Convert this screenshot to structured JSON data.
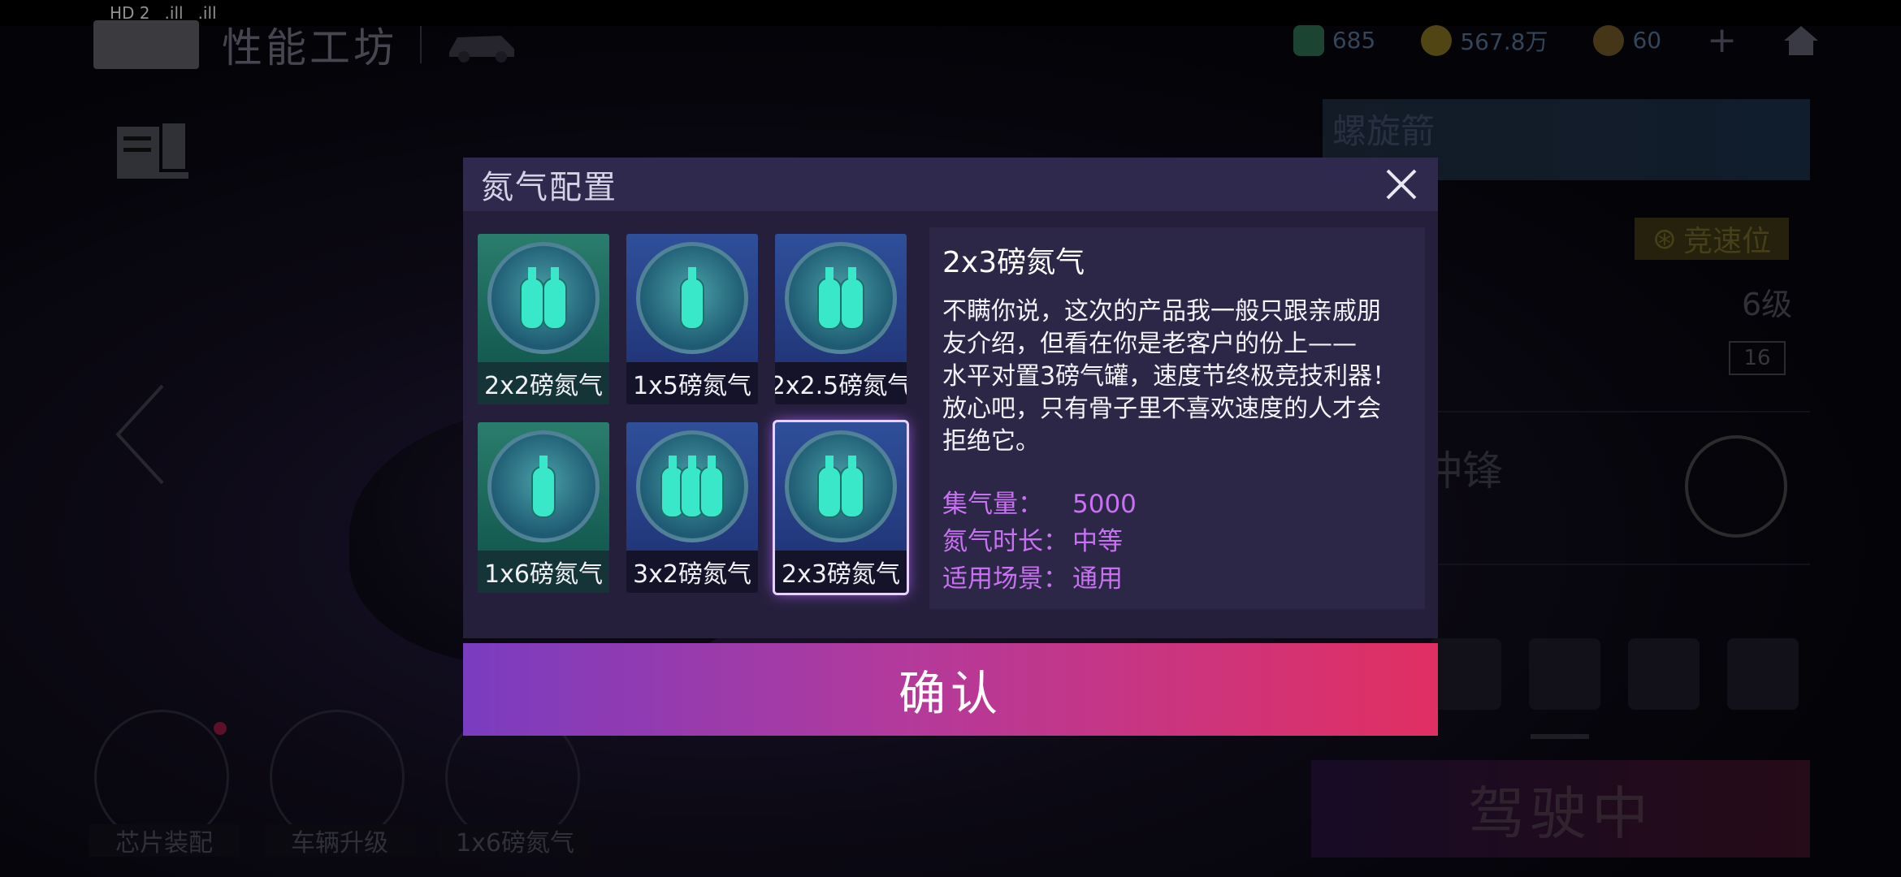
{
  "status_bar": {
    "left_items": [
      "HD 2",
      ".ill",
      ".ill"
    ],
    "right_time": ""
  },
  "header": {
    "title": "性能工坊",
    "currencies": [
      {
        "icon": "ticket-icon",
        "value": "685"
      },
      {
        "icon": "gold-coin-icon",
        "value": "567.8万"
      },
      {
        "icon": "star-coin-icon",
        "value": "60"
      }
    ],
    "plus_label": "+",
    "home_icon": "home-icon"
  },
  "right_panel": {
    "car_name": "螺旋箭",
    "badge": "竞速位",
    "level": "6级",
    "small_stat": "16",
    "skill": "龙卷冲锋",
    "drive_button": "驾驶中"
  },
  "bottom_buttons": [
    {
      "label": "芯片装配",
      "has_dot": true
    },
    {
      "label": "车辆升级",
      "has_dot": false
    },
    {
      "label": "1x6磅氮气",
      "has_dot": false
    }
  ],
  "modal": {
    "title": "氮气配置",
    "tiles": [
      {
        "label": "2x2磅氮气",
        "theme": "green",
        "selected": false
      },
      {
        "label": "1x5磅氮气",
        "theme": "blue",
        "selected": false
      },
      {
        "label": "2x2.5磅氮气",
        "theme": "blue",
        "selected": false
      },
      {
        "label": "1x6磅氮气",
        "theme": "green",
        "selected": false
      },
      {
        "label": "3x2磅氮气",
        "theme": "blue",
        "selected": false
      },
      {
        "label": "2x3磅氮气",
        "theme": "blue",
        "selected": true
      }
    ],
    "detail": {
      "name": "2x3磅氮气",
      "description_lines": [
        "不瞒你说，这次的产品我一般只跟亲戚朋",
        "友介绍，但看在你是老客户的份上——",
        "水平对置3磅气罐，速度节终极竞技利器！",
        "放心吧，只有骨子里不喜欢速度的人才会",
        "拒绝它。"
      ],
      "stats": [
        {
          "key": "集气量：",
          "value": "5000"
        },
        {
          "key": "氮气时长：",
          "value": "中等"
        },
        {
          "key": "适用场景：",
          "value": "通用"
        }
      ]
    },
    "confirm_label": "确认"
  },
  "colors": {
    "accent_purple": "#c872f2",
    "confirm_start": "#7a3cc0",
    "confirm_end": "#e12f62"
  }
}
